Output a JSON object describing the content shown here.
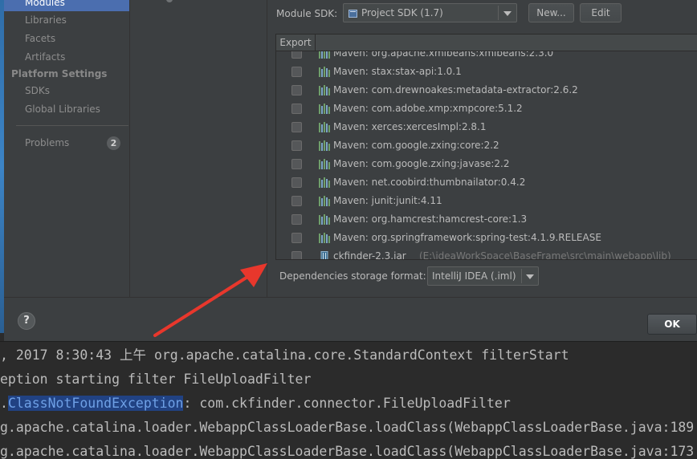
{
  "sidebar": {
    "modules_label": "Modules",
    "libraries_label": "Libraries",
    "facets_label": "Facets",
    "artifacts_label": "Artifacts",
    "platform_settings_header": "Platform Settings",
    "sdks_label": "SDKs",
    "global_libraries_label": "Global Libraries",
    "problems_label": "Problems",
    "problems_count": "2"
  },
  "module_sdk": {
    "label": "Module SDK:",
    "value": "Project SDK (1.7)",
    "new_button": "New...",
    "edit_button": "Edit"
  },
  "dependencies": {
    "export_header": "Export",
    "rows": [
      {
        "name": "Maven: org.apache.xmlbeans:xmlbeans:2.3.0",
        "path": ""
      },
      {
        "name": "Maven: stax:stax-api:1.0.1",
        "path": ""
      },
      {
        "name": "Maven: com.drewnoakes:metadata-extractor:2.6.2",
        "path": ""
      },
      {
        "name": "Maven: com.adobe.xmp:xmpcore:5.1.2",
        "path": ""
      },
      {
        "name": "Maven: xerces:xercesImpl:2.8.1",
        "path": ""
      },
      {
        "name": "Maven: com.google.zxing:core:2.2",
        "path": ""
      },
      {
        "name": "Maven: com.google.zxing:javase:2.2",
        "path": ""
      },
      {
        "name": "Maven: net.coobird:thumbnailator:0.4.2",
        "path": ""
      },
      {
        "name": "Maven: junit:junit:4.11",
        "path": ""
      },
      {
        "name": "Maven: org.hamcrest:hamcrest-core:1.3",
        "path": ""
      },
      {
        "name": "Maven: org.springframework:spring-test:4.1.9.RELEASE",
        "path": ""
      },
      {
        "name": "ckfinder-2.3.jar",
        "path": "(E:\\ideaWorkSpace\\BaseFrame\\src\\main\\webapp\\lib)"
      }
    ]
  },
  "storage": {
    "label": "Dependencies storage format:",
    "value": "IntelliJ IDEA (.iml)"
  },
  "bottom": {
    "help_label": "?",
    "ok_label": "OK"
  },
  "console": {
    "line1": ", 2017 8:30:43 上午 org.apache.catalina.core.StandardContext filterStart",
    "line2": "eption starting filter FileUploadFilter",
    "line3_prefix": ".",
    "line3_highlight": "ClassNotFoundException",
    "line3_rest": ": com.ckfinder.connector.FileUploadFilter",
    "line4": "g.apache.catalina.loader.WebappClassLoaderBase.loadClass(WebappClassLoaderBase.java:189",
    "line5": "g.apache.catalina.loader.WebappClassLoaderBase.loadClass(WebappClassLoaderBase.java:173"
  },
  "colors": {
    "selection": "#4b6eaf",
    "annotation_arrow": "#e8372c",
    "highlight_bg": "#214283"
  }
}
